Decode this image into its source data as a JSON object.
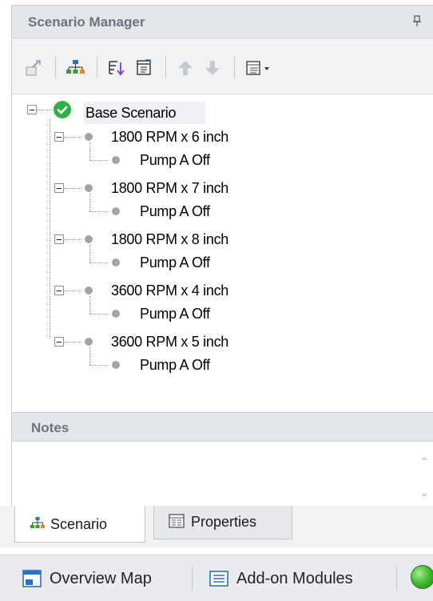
{
  "scenario_manager": {
    "title": "Scenario Manager",
    "toolbar_icons": [
      "promote-icon",
      "scenario-tree-icon",
      "sort-icon",
      "filter-icon",
      "move-up-icon",
      "move-down-icon",
      "view-options-icon"
    ],
    "tree": {
      "root": {
        "label": "Base Scenario",
        "status": "checked"
      },
      "children": [
        {
          "label": "1800 RPM x 6 inch",
          "children": [
            {
              "label": "Pump A Off"
            }
          ]
        },
        {
          "label": "1800 RPM x 7 inch",
          "children": [
            {
              "label": "Pump A Off"
            }
          ]
        },
        {
          "label": "1800 RPM x 8 inch",
          "children": [
            {
              "label": "Pump A Off"
            }
          ]
        },
        {
          "label": "3600 RPM x 4 inch",
          "children": [
            {
              "label": "Pump A Off"
            }
          ]
        },
        {
          "label": "3600 RPM x 5 inch",
          "children": [
            {
              "label": "Pump A Off"
            }
          ]
        }
      ]
    }
  },
  "notes": {
    "title": "Notes",
    "value": ""
  },
  "tabs": [
    {
      "label": "Scenario",
      "active": true,
      "icon": "scenario-tree-icon"
    },
    {
      "label": "Properties",
      "active": false,
      "icon": "properties-icon"
    }
  ],
  "bottom_bar": {
    "items": [
      {
        "label": "Overview Map",
        "icon": "overview-map-icon"
      },
      {
        "label": "Add-on Modules",
        "icon": "add-on-modules-icon"
      }
    ],
    "status_color": "#3db12c"
  },
  "colors": {
    "accent_check": "#2fb14a",
    "panel_header": "#e3e6eb"
  }
}
